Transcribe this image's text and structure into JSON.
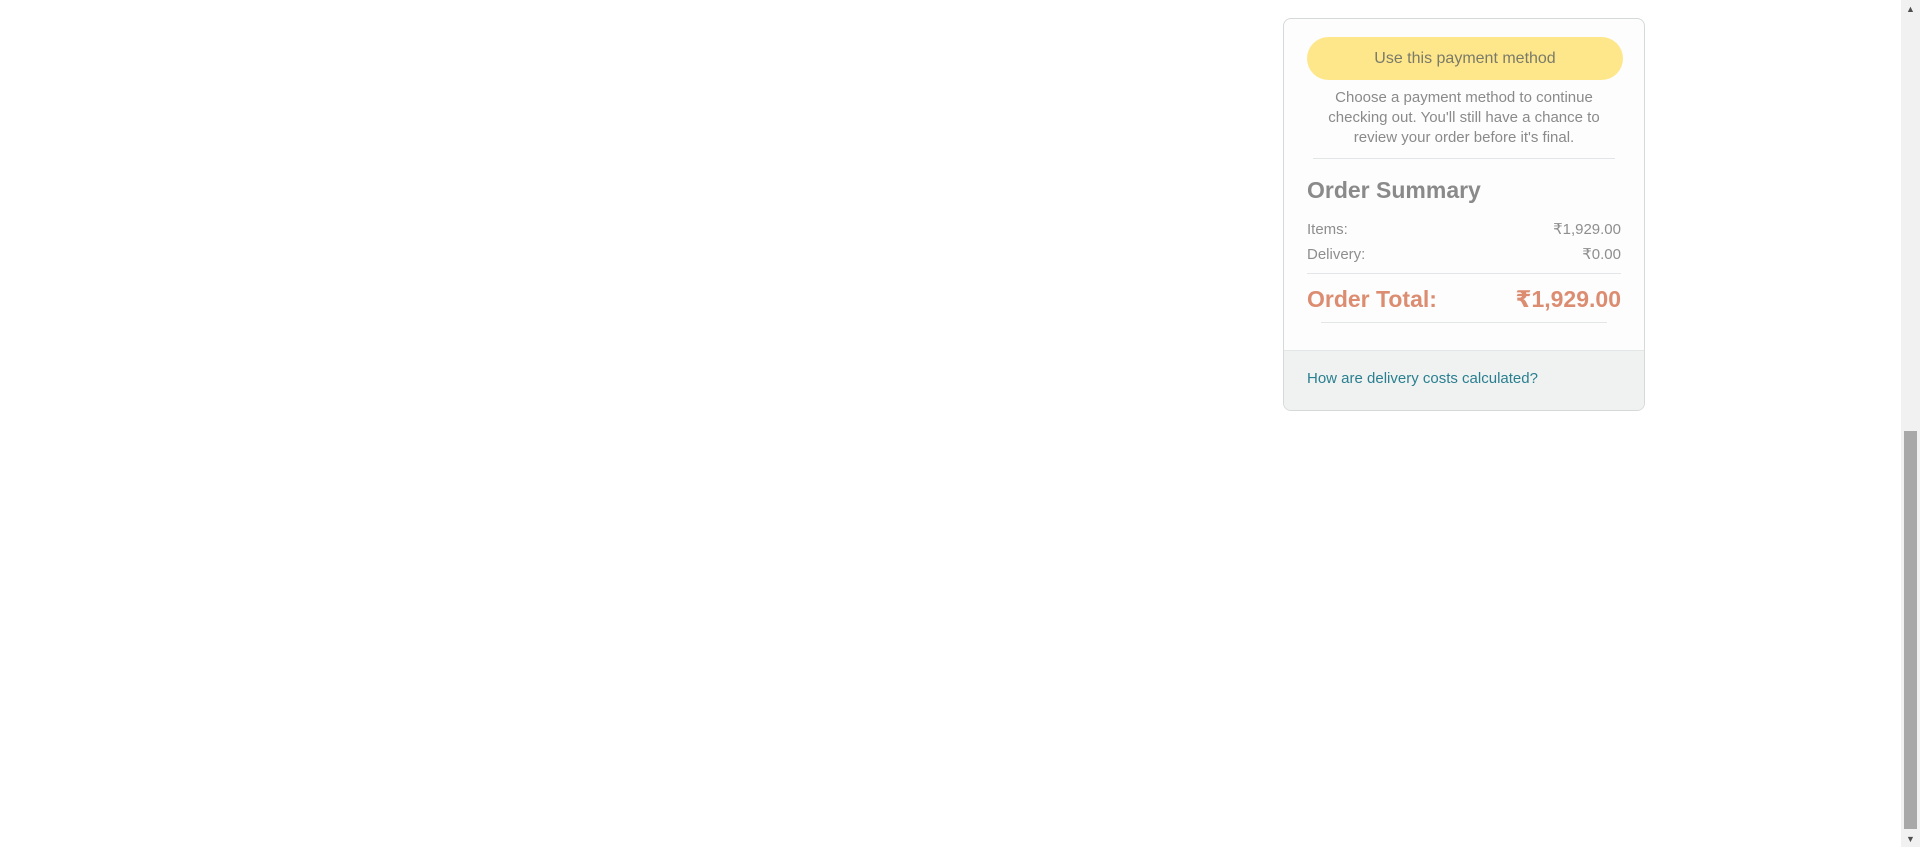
{
  "summary": {
    "use_payment_button_label": "Use this payment method",
    "helper_text": "Choose a payment method to continue checking out. You'll still have a chance to review your order before it's final.",
    "title": "Order Summary",
    "items_label": "Items:",
    "items_value": "₹1,929.00",
    "delivery_label": "Delivery:",
    "delivery_value": "₹0.00",
    "total_label": "Order Total:",
    "total_value": "₹1,929.00",
    "delivery_link": "How are delivery costs calculated?"
  },
  "colors": {
    "button_bg": "#fee78a",
    "total_color": "#dc8d71",
    "link_color": "#2a7f8f"
  },
  "scrollbar": {
    "up_icon": "triangle-up-icon",
    "down_icon": "triangle-down-icon"
  }
}
